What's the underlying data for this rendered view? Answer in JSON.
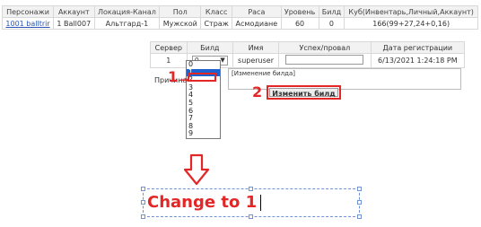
{
  "top_table": {
    "headers": [
      "Персонажи",
      "Аккаунт",
      "Локация-Канал",
      "Пол",
      "Класс",
      "Раса",
      "Уровень",
      "Билд",
      "Куб(Инвентарь,Личный,Аккаунт)"
    ],
    "row": [
      "1001 balltrir",
      "1 Ball007",
      "Альтгард-1",
      "Мужской",
      "Страж",
      "Асмодиане",
      "60",
      "0",
      "166(99+27,24+0,16)"
    ]
  },
  "sub_table": {
    "headers": [
      "Сервер",
      "Билд",
      "Имя",
      "Успех/провал",
      "Дата регистрации"
    ],
    "row": {
      "server": "1",
      "build_value": "0",
      "name": "superuser",
      "date": "6/13/2021 1:24:18 PM"
    }
  },
  "reason": {
    "label": "Причина",
    "textarea_value": "[Изменение билда]"
  },
  "dropdown": {
    "options": [
      "0",
      "1",
      "2",
      "3",
      "4",
      "5",
      "6",
      "7",
      "8",
      "9"
    ],
    "selected_index": 1
  },
  "annotations": {
    "step1": "1",
    "step2": "2",
    "instruction": "Change to 1"
  },
  "change_build_button": "Изменить билд"
}
